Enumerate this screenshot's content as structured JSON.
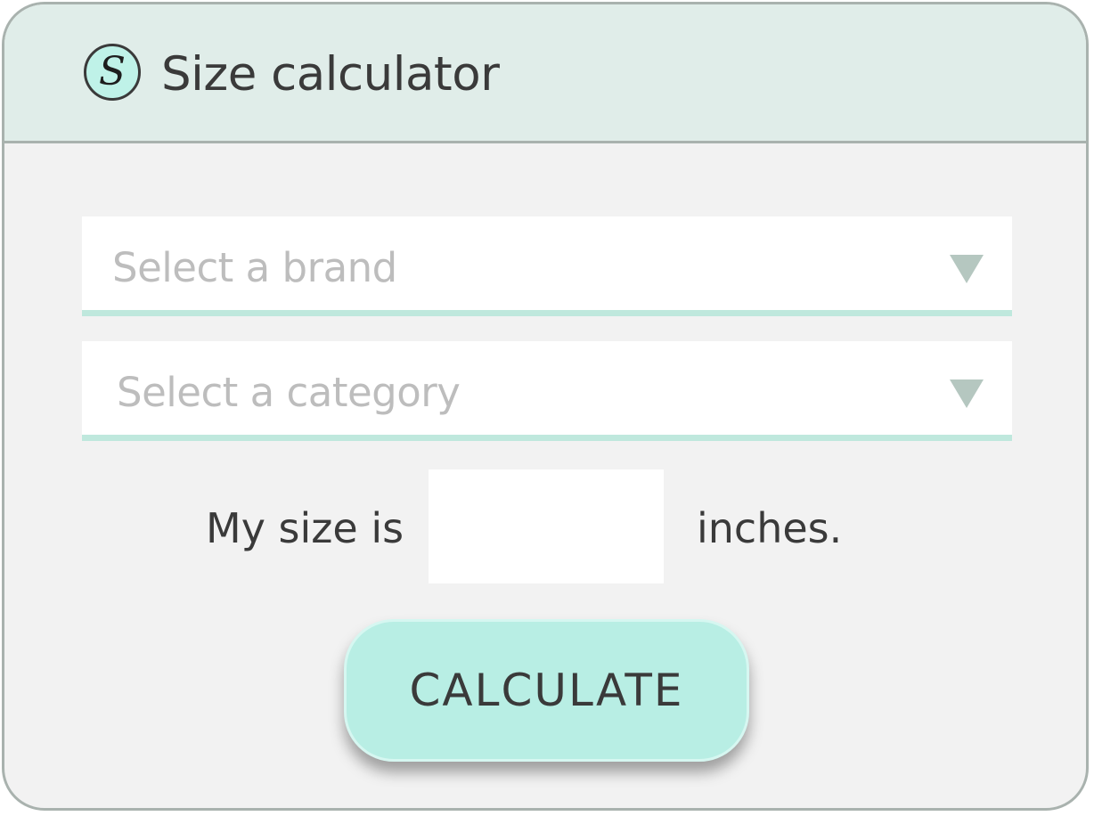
{
  "header": {
    "logo_letter": "S",
    "title": "Size calculator"
  },
  "form": {
    "brand_select": {
      "placeholder": "Select a brand"
    },
    "category_select": {
      "placeholder": "Select a category"
    },
    "size_prefix": "My size is",
    "size_value": "",
    "size_suffix": "inches.",
    "calculate_label": "CALCULATE"
  },
  "icons": {
    "logo": "s-logo-icon",
    "dropdown": "triangle-down-icon"
  },
  "colors": {
    "header_bg": "#e0ede9",
    "body_bg": "#f2f2f2",
    "accent": "#b8eee4",
    "underline": "#bfe8dd",
    "border": "#a9b2ae",
    "placeholder_text": "#bdbdbd",
    "text": "#3a3a3a"
  }
}
